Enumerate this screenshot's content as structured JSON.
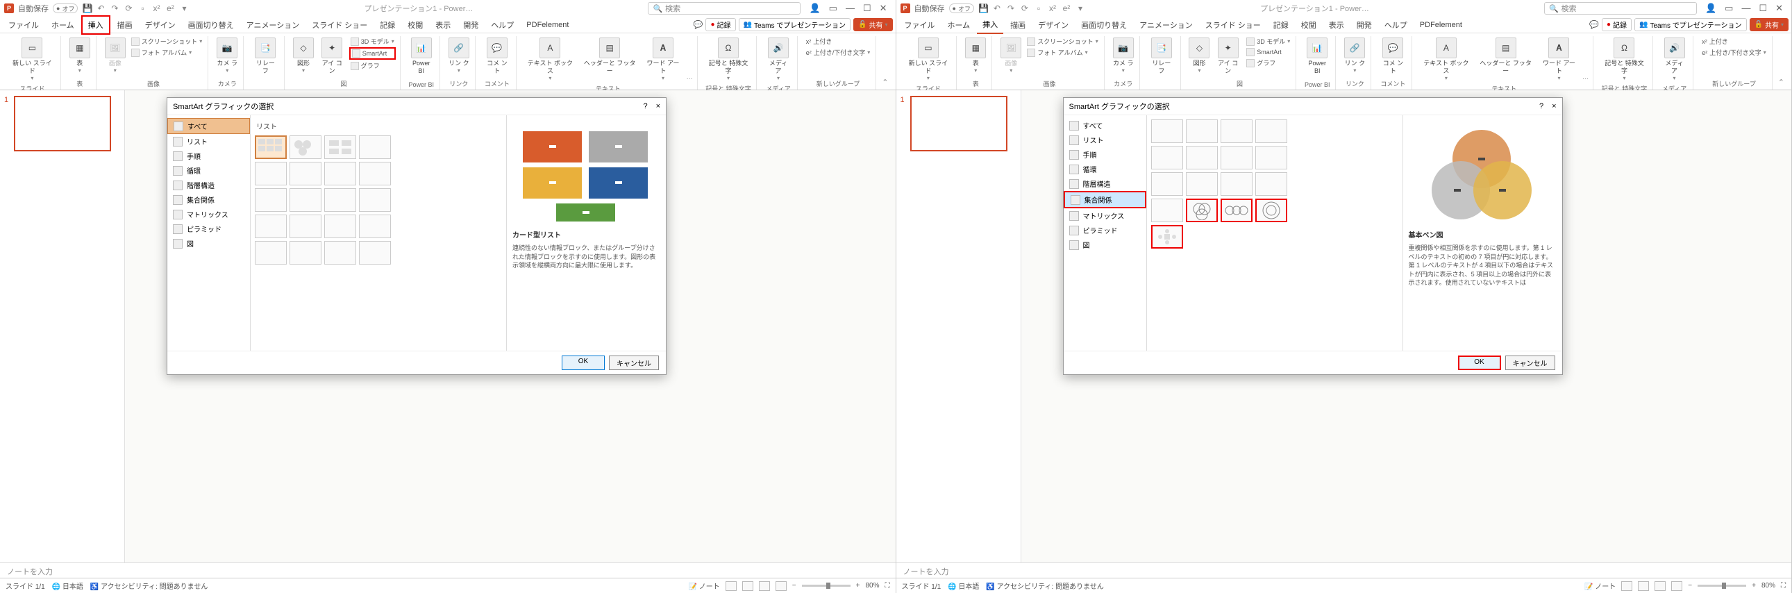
{
  "title_bar": {
    "autosave_label": "自動保存",
    "autosave_state": "オフ",
    "doc_title": "プレゼンテーション1 - Power…",
    "search_placeholder": "検索"
  },
  "menu": {
    "tabs": [
      "ファイル",
      "ホーム",
      "挿入",
      "描画",
      "デザイン",
      "画面切り替え",
      "アニメーション",
      "スライド ショー",
      "記録",
      "校閲",
      "表示",
      "開発",
      "ヘルプ",
      "PDFelement"
    ],
    "active_index": 2,
    "record": "記録",
    "teams": "Teams でプレゼンテーション",
    "share": "共有"
  },
  "ribbon": {
    "groups": {
      "slide": {
        "label": "スライド",
        "new_slide": "新しい\nスライド"
      },
      "table": {
        "label": "表",
        "btn": "表"
      },
      "image_group": {
        "label": "画像",
        "image": "画像",
        "screenshot": "スクリーンショット",
        "photo_album": "フォト アルバム"
      },
      "camera": {
        "label": "カメラ",
        "btn": "カメ\nラ"
      },
      "reuse": {
        "label": "",
        "btn": "リレー\nフ"
      },
      "illust": {
        "label": "図",
        "shape": "図形",
        "icon": "アイ\nコン",
        "model3d": "3D モデル",
        "smartart": "SmartArt",
        "chart": "グラフ"
      },
      "powerbi": {
        "label": "Power BI",
        "btn": "Power\nBI"
      },
      "link": {
        "label": "リンク",
        "btn": "リン\nク"
      },
      "comment": {
        "label": "コメント",
        "btn": "コメ\nント"
      },
      "text": {
        "label": "テキスト",
        "textbox": "テキスト\nボックス",
        "headerfooter": "ヘッダーと\nフッター",
        "wordart": "ワード\nアート"
      },
      "symbol": {
        "label": "記号と\n特殊文字",
        "btn": "記号と\n特殊文字"
      },
      "media": {
        "label": "メディア",
        "btn": "メディ\nア"
      },
      "new_group": {
        "label": "新しいグループ",
        "item1": "上付き",
        "item2": "上付き/下付き文字"
      }
    }
  },
  "dialog": {
    "title": "SmartArt グラフィックの選択",
    "categories": [
      "すべて",
      "リスト",
      "手順",
      "循環",
      "階層構造",
      "集合関係",
      "マトリックス",
      "ピラミッド",
      "図"
    ],
    "list_label": "リスト",
    "ok": "OK",
    "cancel": "キャンセル",
    "help": "?",
    "close": "×",
    "preview_left": {
      "title": "カード型リスト",
      "desc": "連続性のない情報ブロック、またはグループ分けされた情報ブロックを示すのに使用します。図形の表示領域を縦横両方向に最大限に使用します。"
    },
    "preview_right": {
      "title": "基本ベン図",
      "desc": "重複関係や相互関係を示すのに使用します。第 1 レベルのテキストの初めの 7 項目が円に対応します。第 1 レベルのテキストが 4 項目以下の場合はテキストが円内に表示され、5 項目以上の場合は円外に表示されます。使用されていないテキストは"
    }
  },
  "thumb": {
    "num": "1"
  },
  "notes": {
    "placeholder": "ノートを入力"
  },
  "status": {
    "slide": "スライド 1/1",
    "lang": "日本語",
    "access": "アクセシビリティ: 問題ありません",
    "notes_btn": "ノート",
    "zoom": "80%"
  }
}
